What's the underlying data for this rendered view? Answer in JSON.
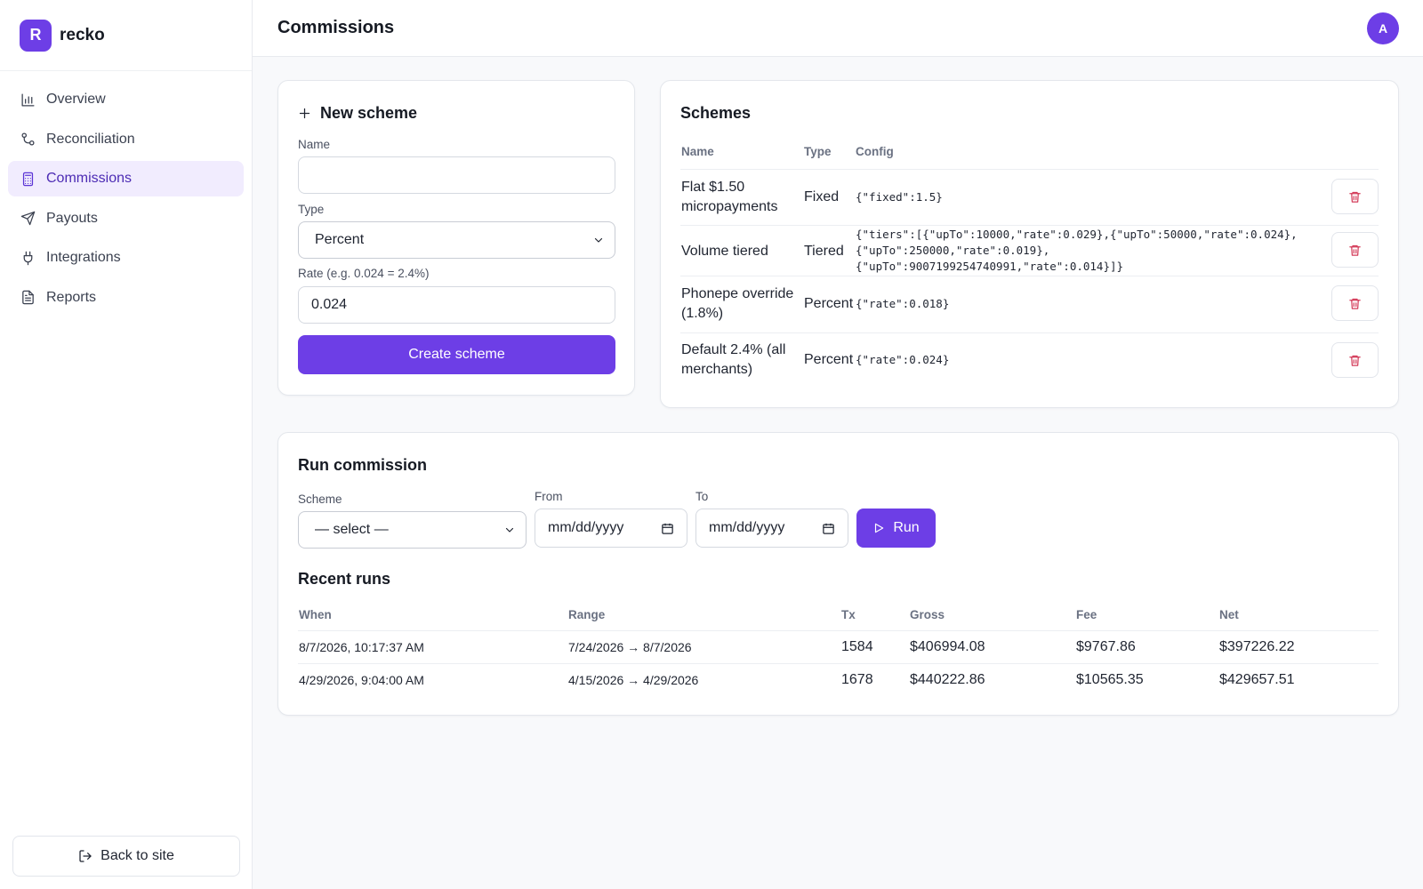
{
  "brand": {
    "logo_letter": "R",
    "name": "recko",
    "accent": "#6d3ee6"
  },
  "sidebar": {
    "items": [
      {
        "label": "Overview",
        "icon": "bar-chart-icon"
      },
      {
        "label": "Reconciliation",
        "icon": "git-merge-icon"
      },
      {
        "label": "Commissions",
        "icon": "calculator-icon",
        "active": true
      },
      {
        "label": "Payouts",
        "icon": "send-icon"
      },
      {
        "label": "Integrations",
        "icon": "plug-icon"
      },
      {
        "label": "Reports",
        "icon": "file-text-icon"
      }
    ],
    "back_label": "Back to site"
  },
  "header": {
    "title": "Commissions",
    "avatar_initial": "A"
  },
  "new_scheme": {
    "title": "New scheme",
    "name_label": "Name",
    "name_value": "",
    "type_label": "Type",
    "type_value": "Percent",
    "rate_label": "Rate (e.g. 0.024 = 2.4%)",
    "rate_value": "0.024",
    "submit_label": "Create scheme"
  },
  "schemes": {
    "title": "Schemes",
    "columns": [
      "Name",
      "Type",
      "Config"
    ],
    "rows": [
      {
        "name_line1": "Flat $1.50",
        "name_line2": "micropayments",
        "type": "Fixed",
        "config_lines": [
          "{\"fixed\":1.5}"
        ]
      },
      {
        "name_line1": "Volume tiered",
        "name_line2": "",
        "type": "Tiered",
        "config_lines": [
          "{\"tiers\":[{\"upTo\":10000,\"rate\":0.029},{\"upTo\":50000,\"rate\":0.024},",
          "{\"upTo\":250000,\"rate\":0.019},",
          "{\"upTo\":9007199254740991,\"rate\":0.014}]}"
        ]
      },
      {
        "name_line1": "Phonepe override",
        "name_line2": "(1.8%)",
        "type": "Percent",
        "config_lines": [
          "{\"rate\":0.018}"
        ]
      },
      {
        "name_line1": "Default 2.4% (all",
        "name_line2": "merchants)",
        "type": "Percent",
        "config_lines": [
          "{\"rate\":0.024}"
        ]
      }
    ]
  },
  "run": {
    "title": "Run commission",
    "scheme_label": "Scheme",
    "scheme_value": "— select —",
    "from_label": "From",
    "from_placeholder": "mm/dd/yyyy",
    "to_label": "To",
    "to_placeholder": "mm/dd/yyyy",
    "run_label": "Run"
  },
  "recent_runs": {
    "title": "Recent runs",
    "columns": [
      "When",
      "Range",
      "Tx",
      "Gross",
      "Fee",
      "Net"
    ],
    "rows": [
      {
        "when": "8/7/2026, 10:17:37 AM",
        "range": "7/24/2026 → 8/7/2026",
        "tx": "1584",
        "gross": "$406994.08",
        "fee": "$9767.86",
        "net": "$397226.22"
      },
      {
        "when": "4/29/2026, 9:04:00 AM",
        "range": "4/15/2026 → 4/29/2026",
        "tx": "1678",
        "gross": "$440222.86",
        "fee": "$10565.35",
        "net": "$429657.51"
      }
    ]
  }
}
